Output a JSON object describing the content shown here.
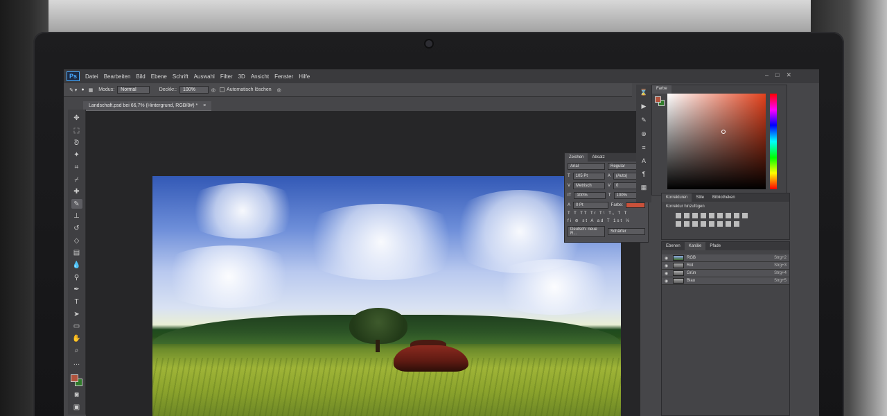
{
  "menubar": {
    "logo": "Ps",
    "items": [
      "Datei",
      "Bearbeiten",
      "Bild",
      "Ebene",
      "Schrift",
      "Auswahl",
      "Filter",
      "3D",
      "Ansicht",
      "Fenster",
      "Hilfe"
    ]
  },
  "options": {
    "mode_label": "Modus:",
    "mode_value": "Normal",
    "opacity_label": "Deckkr.:",
    "opacity_value": "100%",
    "auto_erase_label": "Automatisch löschen"
  },
  "document": {
    "tab_title": "Landschaft.psd bei 66,7% (Hintergrund, RGB/8#) *",
    "close": "×"
  },
  "character_panel": {
    "tabs": [
      "Zeichen",
      "Absatz"
    ],
    "font_family": "Arial",
    "font_style": "Regular",
    "font_size": "105 Pt",
    "leading": "(Auto)",
    "kerning": "Metrisch",
    "tracking": "0",
    "vertical_scale": "100%",
    "horizontal_scale": "100%",
    "baseline_shift": "0 Pt",
    "color_label": "Farbe:",
    "language": "Deutsch: neue R...",
    "antialias": "Schärfer"
  },
  "color_panel": {
    "tab": "Farbe"
  },
  "adjustments_panel": {
    "tabs": [
      "Korrekturen",
      "Stile",
      "Bibliotheken"
    ],
    "title": "Korrektur hinzufügen"
  },
  "layers_panel": {
    "tabs": [
      "Ebenen",
      "Kanäle",
      "Pfade"
    ],
    "channels": [
      {
        "name": "RGB",
        "shortcut": "Strg+2"
      },
      {
        "name": "Rot",
        "shortcut": "Strg+3"
      },
      {
        "name": "Grün",
        "shortcut": "Strg+4"
      },
      {
        "name": "Blau",
        "shortcut": "Strg+5"
      }
    ]
  },
  "colors": {
    "accent": "#47a9ff",
    "text_color_chip": "#c9513a",
    "foreground": "#b0533d",
    "background": "#2f7a2a"
  }
}
